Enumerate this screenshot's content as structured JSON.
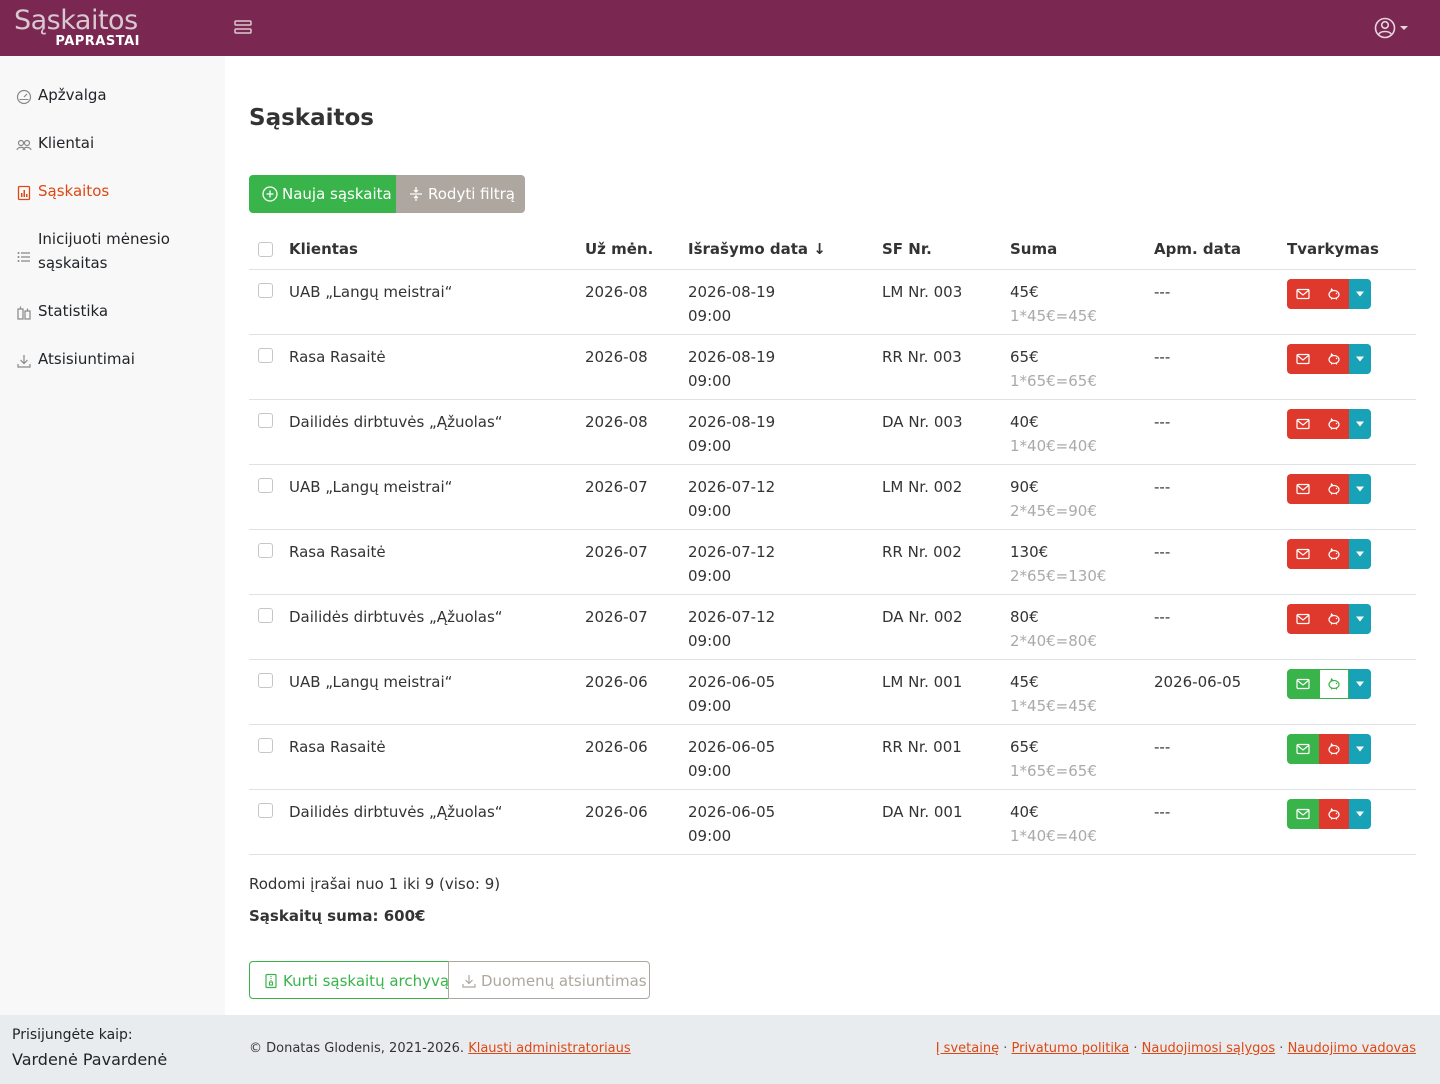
{
  "brand": {
    "main": "Sąskaitos",
    "sub": "PAPRASTAI"
  },
  "sidebar": {
    "items": [
      {
        "label": "Apžvalga",
        "icon": "speedometer-icon"
      },
      {
        "label": "Klientai",
        "icon": "people-icon"
      },
      {
        "label": "Sąskaitos",
        "icon": "bar-chart-file-icon",
        "active": true
      },
      {
        "label": "Inicijuoti mėnesio sąskaitas",
        "icon": "list-icon"
      },
      {
        "label": "Statistika",
        "icon": "buildings-icon"
      },
      {
        "label": "Atsisiuntimai",
        "icon": "download-icon"
      }
    ],
    "login_as_label": "Prisijungėte kaip:",
    "user_name": "Vardenė Pavardenė"
  },
  "main": {
    "title": "Sąskaitos",
    "new_invoice_label": "Nauja sąskaita",
    "show_filter_label": "Rodyti filtrą",
    "columns": {
      "client": "Klientas",
      "month": "Už mėn.",
      "issue_date": "Išrašymo data ↓",
      "number": "SF Nr.",
      "sum": "Suma",
      "paid_date": "Apm. data",
      "manage": "Tvarkymas"
    },
    "rows": [
      {
        "client": "UAB „Langų meistrai“",
        "month": "2026-08",
        "date": "2026-08-19",
        "time": "09:00",
        "number": "LM Nr. 003",
        "sum": "45€",
        "calc": "1*45€=45€",
        "paid": "---",
        "mail": "red",
        "pay": "red"
      },
      {
        "client": "Rasa Rasaitė",
        "month": "2026-08",
        "date": "2026-08-19",
        "time": "09:00",
        "number": "RR Nr. 003",
        "sum": "65€",
        "calc": "1*65€=65€",
        "paid": "---",
        "mail": "red",
        "pay": "red"
      },
      {
        "client": "Dailidės dirbtuvės „Ąžuolas“",
        "month": "2026-08",
        "date": "2026-08-19",
        "time": "09:00",
        "number": "DA Nr. 003",
        "sum": "40€",
        "calc": "1*40€=40€",
        "paid": "---",
        "mail": "red",
        "pay": "red"
      },
      {
        "client": "UAB „Langų meistrai“",
        "month": "2026-07",
        "date": "2026-07-12",
        "time": "09:00",
        "number": "LM Nr. 002",
        "sum": "90€",
        "calc": "2*45€=90€",
        "paid": "---",
        "mail": "red",
        "pay": "red"
      },
      {
        "client": "Rasa Rasaitė",
        "month": "2026-07",
        "date": "2026-07-12",
        "time": "09:00",
        "number": "RR Nr. 002",
        "sum": "130€",
        "calc": "2*65€=130€",
        "paid": "---",
        "mail": "red",
        "pay": "red"
      },
      {
        "client": "Dailidės dirbtuvės „Ąžuolas“",
        "month": "2026-07",
        "date": "2026-07-12",
        "time": "09:00",
        "number": "DA Nr. 002",
        "sum": "80€",
        "calc": "2*40€=80€",
        "paid": "---",
        "mail": "red",
        "pay": "red"
      },
      {
        "client": "UAB „Langų meistrai“",
        "month": "2026-06",
        "date": "2026-06-05",
        "time": "09:00",
        "number": "LM Nr. 001",
        "sum": "45€",
        "calc": "1*45€=45€",
        "paid": "2026-06-05",
        "mail": "green",
        "pay": "white"
      },
      {
        "client": "Rasa Rasaitė",
        "month": "2026-06",
        "date": "2026-06-05",
        "time": "09:00",
        "number": "RR Nr. 001",
        "sum": "65€",
        "calc": "1*65€=65€",
        "paid": "---",
        "mail": "green",
        "pay": "red"
      },
      {
        "client": "Dailidės dirbtuvės „Ąžuolas“",
        "month": "2026-06",
        "date": "2026-06-05",
        "time": "09:00",
        "number": "DA Nr. 001",
        "sum": "40€",
        "calc": "1*40€=40€",
        "paid": "---",
        "mail": "green",
        "pay": "red"
      }
    ],
    "records_info": "Rodomi įrašai nuo 1 iki 9 (viso: 9)",
    "total_sum": "Sąskaitų suma: 600€",
    "archive_label": "Kurti sąskaitų archyvą",
    "download_label": "Duomenų atsiuntimas"
  },
  "footer": {
    "copyright": "© Donatas Glodenis, 2021-2026.",
    "ask_admin": "Klausti administratoriaus",
    "links": [
      "Į svetainę",
      "Privatumo politika",
      "Naudojimosi sąlygos",
      "Naudojimo vadovas"
    ],
    "separator": "·"
  },
  "colors": {
    "topbar": "#7a2751",
    "accent": "#dd4814",
    "success": "#38b44a",
    "danger": "#df382c",
    "info": "#17a2b8",
    "secondary": "#aea79f"
  }
}
